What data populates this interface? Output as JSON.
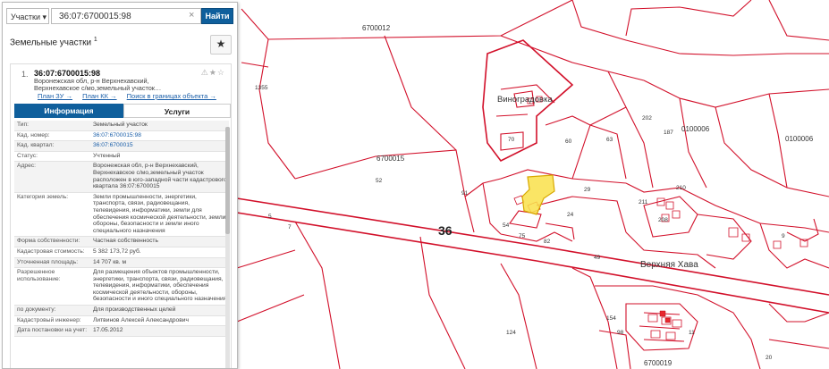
{
  "search": {
    "type_label": "Участки",
    "type_caret": "▾",
    "query": "36:07:6700015:98",
    "clear_icon": "×",
    "find_label": "Найти"
  },
  "section": {
    "title": "Земельные участки",
    "count": "1",
    "fav_icon": "★"
  },
  "result": {
    "number": "1.",
    "title": "36:07:6700015:98",
    "tool_icons": "⚠★☆",
    "address_lines": [
      "Воронежская обл, р-н Верхнехавский,",
      "Верхнехавское с/мо,земельный участок…"
    ],
    "links": [
      "План ЗУ →",
      "План КК →",
      "Поиск в границах объекта →"
    ],
    "tabs": [
      "Информация",
      "Услуги"
    ],
    "rows": [
      {
        "k": "Тип:",
        "v": "Земельный участок"
      },
      {
        "k": "Кад. номер:",
        "v": "36:07:6700015:98"
      },
      {
        "k": "Кад. квартал:",
        "v": "36:07:6700015"
      },
      {
        "k": "Статус:",
        "v": "Учтенный"
      },
      {
        "k": "Адрес:",
        "v": "Воронежская обл, р-н Верхнехавский, Верхнехавское с/мо,земельный участок расположен в юго-западной части кадастрового квартала 36:07:6700015"
      },
      {
        "k": "Категория земель:",
        "v": "Земли промышленности, энергетики, транспорта, связи, радиовещания, телевидения, информатики, земли для обеспечения космической деятельности, земли обороны, безопасности и земли иного специального назначения"
      },
      {
        "k": "Форма собственности:",
        "v": "Частная собственность"
      },
      {
        "k": "Кадастровая стоимость:",
        "v": "5 382 173,72 руб."
      },
      {
        "k": "Уточненная площадь:",
        "v": "14 707 кв. м"
      },
      {
        "k": "Разрешенное использование:",
        "v": "Для размещения объектов промышленности, энергетики, транспорта, связи, радиовещания, телевидения, информатики, обеспечения космической деятельности, обороны, безопасности и иного специального назначения"
      },
      {
        "k": "по документу:",
        "v": "Для производственных целей"
      },
      {
        "k": "Кадастровый инженер:",
        "v": "Литвинов Алексей Александрович"
      },
      {
        "k": "Дата постановки на учет:",
        "v": "17.05.2012"
      }
    ]
  },
  "map": {
    "labels": [
      "6700012",
      "1355",
      "Виноградовка",
      "6700015",
      "36",
      "Верхняя Хава",
      "0100006",
      "0100006",
      "6700019",
      "52",
      "91",
      "60",
      "63",
      "70",
      "5",
      "7",
      "29",
      "24",
      "49",
      "124",
      "82",
      "154",
      "202",
      "187",
      "210",
      "9",
      "208",
      "211",
      "54",
      "75",
      "98",
      "11",
      "20"
    ],
    "colors": {
      "parcel_line": "#d2102a",
      "highlight_fill": "#f9e04a",
      "highlight_line": "#d8a800"
    }
  }
}
